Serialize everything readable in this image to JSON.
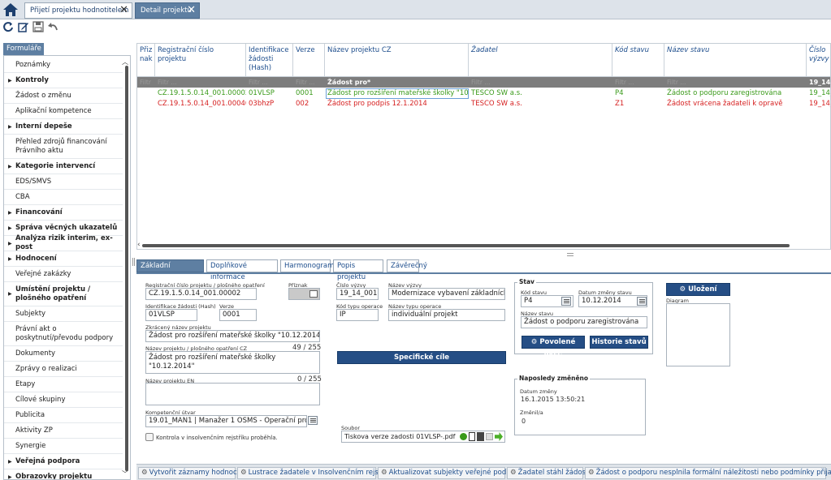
{
  "tabs": {
    "tab1": "Přijetí projektu hodnotitelem",
    "tab2": "Detail projektu"
  },
  "sidebar": {
    "header": "Formuláře",
    "items": [
      {
        "label": "Poznámky",
        "bold": false,
        "arrow": false
      },
      {
        "label": "Kontroly",
        "bold": true,
        "arrow": true
      },
      {
        "label": "Žádost o změnu",
        "bold": false,
        "arrow": false
      },
      {
        "label": "Aplikační kompetence",
        "bold": false,
        "arrow": false
      },
      {
        "label": "Interní depeše",
        "bold": true,
        "arrow": true
      },
      {
        "label": "Přehled zdrojů financování Právního aktu",
        "bold": false,
        "arrow": false
      },
      {
        "label": "Kategorie intervencí",
        "bold": true,
        "arrow": true
      },
      {
        "label": "EDS/SMVS",
        "bold": false,
        "arrow": false
      },
      {
        "label": "CBA",
        "bold": false,
        "arrow": false
      },
      {
        "label": "Financování",
        "bold": true,
        "arrow": true
      },
      {
        "label": "Správa věcných ukazatelů",
        "bold": true,
        "arrow": true
      },
      {
        "label": "Analýza rizik interim, ex-post",
        "bold": true,
        "arrow": true
      },
      {
        "label": "Hodnocení",
        "bold": true,
        "arrow": true
      },
      {
        "label": "Veřejné zakázky",
        "bold": false,
        "arrow": false
      },
      {
        "label": "Umístění projektu / plošného opatření",
        "bold": true,
        "arrow": true
      },
      {
        "label": "Subjekty",
        "bold": false,
        "arrow": false
      },
      {
        "label": "Právní akt o poskytnutí/převodu podpory",
        "bold": false,
        "arrow": false
      },
      {
        "label": "Dokumenty",
        "bold": false,
        "arrow": false
      },
      {
        "label": "Zprávy o realizaci",
        "bold": false,
        "arrow": false
      },
      {
        "label": "Etapy",
        "bold": false,
        "arrow": false
      },
      {
        "label": "Cílové skupiny",
        "bold": false,
        "arrow": false
      },
      {
        "label": "Publicita",
        "bold": false,
        "arrow": false
      },
      {
        "label": "Aktivity ZP",
        "bold": false,
        "arrow": false
      },
      {
        "label": "Synergie",
        "bold": false,
        "arrow": false
      },
      {
        "label": "Veřejná podpora",
        "bold": true,
        "arrow": true
      },
      {
        "label": "Obrazovky projektu",
        "bold": true,
        "arrow": true
      }
    ]
  },
  "grid": {
    "headers": [
      "Přiz nak",
      "Registrační číslo projektu",
      "Identifikace žádosti (Hash)",
      "Verze",
      "Název projektu CZ",
      "Žadatel",
      "Kód stavu",
      "Název stavu",
      "Číslo výzvy"
    ],
    "filters": [
      "Filtr",
      "Filtr ...",
      "Filtr ...",
      "Filtr ...",
      "Žádost pro*",
      "Filtr ...",
      "Filtr ...",
      "Filtr ...",
      "19_14_"
    ],
    "rows": [
      [
        "",
        "CZ.19.1.5.0.14_001.00002",
        "01VLSP",
        "0001",
        "Žádost pro rozšíření mateřské školky \"10.12.2",
        "TESCO SW a.s.",
        "P4",
        "Žádost o podporu zaregistrována",
        "19_14_"
      ],
      [
        "",
        "CZ.19.1.5.0.14_001.00040",
        "03bhzP",
        "002",
        "Žádost pro podpis 12.1.2014",
        "TESCO SW a.s.",
        "Z1",
        "Žádost vrácena žadateli k opravě",
        "19_14_"
      ]
    ]
  },
  "detail_tabs": [
    "Základní informace",
    "Doplňkové informace",
    "Harmonogram",
    "Popis projektu",
    "Závěrečný"
  ],
  "form": {
    "reg_label": "Registrační číslo projektu / plošného opatření",
    "reg_value": "CZ.19.1.5.0.14_001.00002",
    "priznak_label": "Příznak",
    "hash_label": "Identifikace žádosti (Hash)",
    "hash_value": "01VLSP",
    "verze_label": "Verze",
    "verze_value": "0001",
    "short_label": "Zkrácený název projektu",
    "short_value": "Žádost pro rozšíření mateřské školky \"10.12.2014\"",
    "name_cz_label": "Název projektu / plošného opatření CZ",
    "name_cz_count": "49 / 255",
    "name_cz_value": "Žádost pro rozšíření mateřské školky \"10.12.2014\"",
    "name_en_label": "Název projektu EN",
    "name_en_count": "0 / 255",
    "name_en_value": "",
    "komp_label": "Kompetenční útvar",
    "komp_value": "19.01_MAN1 | Manažer 1 OSMS - Operační program |",
    "insolv_label": "Kontrola v insolvenčním rejstříku proběhla.",
    "vyzva_label": "Číslo výzvy",
    "vyzva_value": "19_14_001",
    "nazev_vyzvy_label": "Název výzvy",
    "nazev_vyzvy_value": "Modernizace vybavení základních ško",
    "kod_typu_label": "Kód typu operace",
    "kod_typu_value": "IP",
    "nazev_typu_label": "Název typu operace",
    "nazev_typu_value": "individuální projekt",
    "specific_btn": "Specifické cíle",
    "soubor_label": "Soubor",
    "soubor_value": "Tiskova verze zadosti 01VLSP-.pdf"
  },
  "stav": {
    "title": "Stav",
    "kod_label": "Kód stavu",
    "kod_value": "P4",
    "datum_label": "Datum změny stavu",
    "datum_value": "10.12.2014",
    "nazev_label": "Název stavu",
    "nazev_value": "Žádost o podporu zaregistrována",
    "btn_akce": "Povolené akce",
    "btn_historie": "Historie stavů"
  },
  "naposledy": {
    "title": "Naposledy změněno",
    "datum_label": "Datum změny",
    "datum_value": "16.1.2015 13:50:21",
    "zmenil_label": "Změnil/a",
    "zmenil_value": "0"
  },
  "diagram": {
    "btn": "Uložení diagramu",
    "label": "Diagram"
  },
  "bottom_actions": [
    "Vytvořit záznamy hodnocení",
    "Lustrace žadatele v Insolvenčním rejstříku",
    "Aktualizovat subjekty veřejné podpory",
    "Žadatel stáhl žádost",
    "Žádost o podporu nesplnila formální náležitosti nebo podmínky přijatelnosti"
  ],
  "colors": {
    "accent": "#5e7fa2",
    "header_text": "#1d4d8c",
    "ok_green": "#3a9a1a",
    "err_red": "#d62020",
    "button_blue": "#254e85"
  }
}
